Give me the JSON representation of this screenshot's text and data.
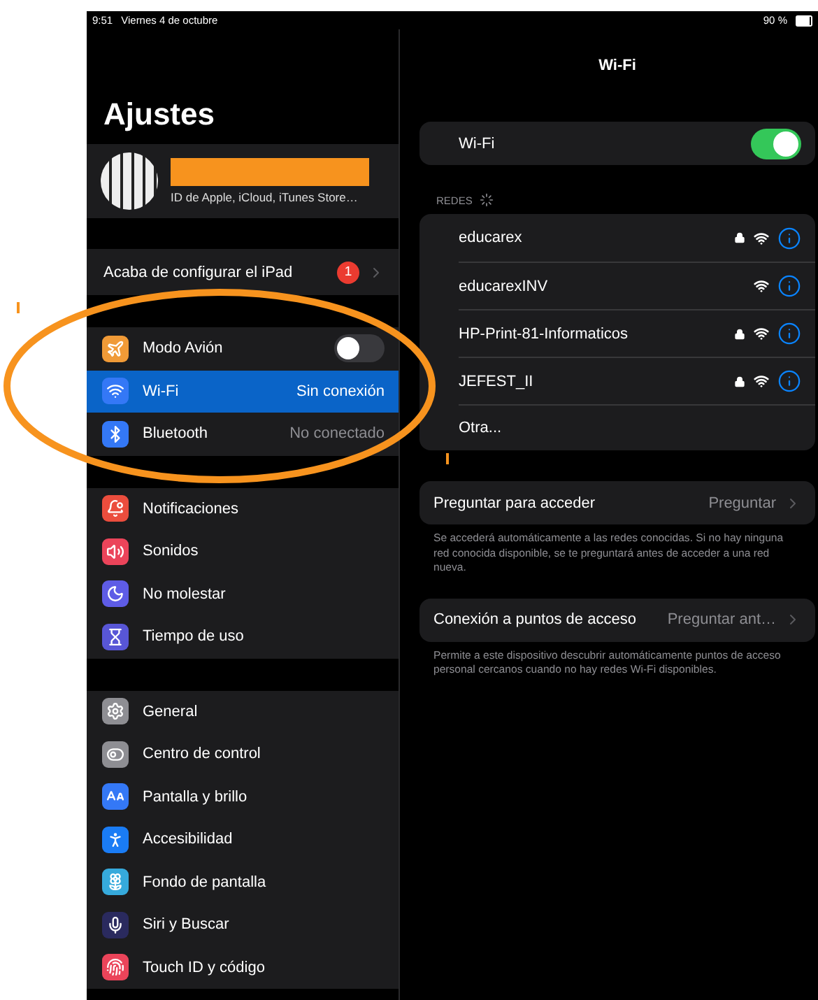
{
  "status_bar": {
    "time": "9:51",
    "date": "Viernes 4 de octubre",
    "battery": "90 %"
  },
  "sidebar": {
    "title": "Ajustes",
    "profile": {
      "subtitle": "ID de Apple, iCloud, iTunes Store…"
    },
    "setup_row": {
      "label": "Acaba de configurar el iPad",
      "badge": "1"
    },
    "groups": [
      {
        "items": [
          {
            "kind": "toggle",
            "label": "Modo Avión",
            "color": "#f09a37",
            "on": false,
            "selected": false
          },
          {
            "kind": "value",
            "label": "Wi-Fi",
            "color": "#3478f6",
            "value": "Sin conexión",
            "selected": true
          },
          {
            "kind": "value",
            "label": "Bluetooth",
            "color": "#3478f6",
            "value": "No conectado",
            "selected": false
          }
        ]
      },
      {
        "items": [
          {
            "kind": "link",
            "label": "Notificaciones",
            "color": "#eb4d3d",
            "selected": false
          },
          {
            "kind": "link",
            "label": "Sonidos",
            "color": "#eb445a",
            "selected": false
          },
          {
            "kind": "link",
            "label": "No molestar",
            "color": "#5e5ce6",
            "selected": false
          },
          {
            "kind": "link",
            "label": "Tiempo de uso",
            "color": "#5856d6",
            "selected": false
          }
        ]
      },
      {
        "items": [
          {
            "kind": "link",
            "label": "General",
            "color": "#8e8e93",
            "selected": false
          },
          {
            "kind": "link",
            "label": "Centro de control",
            "color": "#8e8e93",
            "selected": false
          },
          {
            "kind": "link",
            "label": "Pantalla y brillo",
            "color": "#3478f6",
            "selected": false
          },
          {
            "kind": "link",
            "label": "Accesibilidad",
            "color": "#1a7cf5",
            "selected": false
          },
          {
            "kind": "link",
            "label": "Fondo de pantalla",
            "color": "#36aadc",
            "selected": false
          },
          {
            "kind": "link",
            "label": "Siri y Buscar",
            "color": "#2a2a5e",
            "selected": false
          },
          {
            "kind": "link",
            "label": "Touch ID y código",
            "color": "#eb445a",
            "selected": false
          }
        ]
      }
    ]
  },
  "detail": {
    "title": "Wi-Fi",
    "wifi_toggle": {
      "label": "Wi-Fi",
      "on": true
    },
    "networks_header": "REDES",
    "networks": [
      {
        "name": "educarex",
        "locked": true
      },
      {
        "name": "educarexINV",
        "locked": false
      },
      {
        "name": "HP-Print-81-Informaticos",
        "locked": true
      },
      {
        "name": "JEFEST_II",
        "locked": true
      }
    ],
    "other_network": "Otra...",
    "settings": [
      {
        "label": "Preguntar para acceder",
        "value": "Preguntar",
        "footer": "Se accederá automáticamente a las redes conocidas. Si no hay ninguna red conocida disponible, se te preguntará antes de acceder a una red nueva."
      },
      {
        "label": "Conexión a puntos de acceso",
        "value": "Preguntar ant…",
        "footer": "Permite a este dispositivo descubrir automáticamente puntos de acceso personal cercanos cuando no hay redes Wi-Fi disponibles."
      }
    ]
  }
}
